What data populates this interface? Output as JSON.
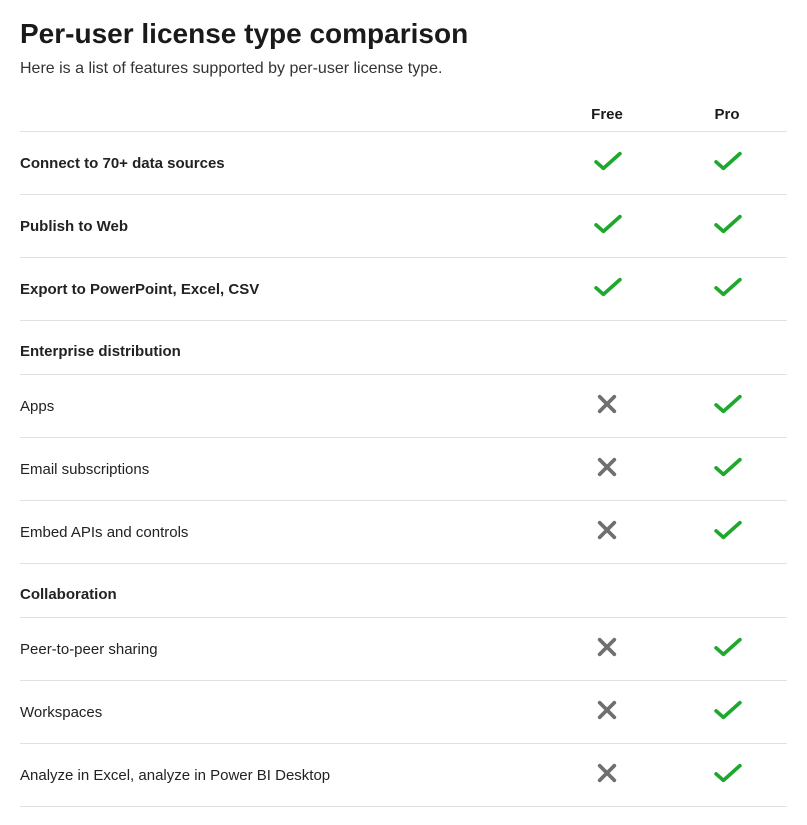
{
  "title": "Per-user license type comparison",
  "subtitle": "Here is a list of features supported by per-user license type.",
  "columns": [
    "Free",
    "Pro"
  ],
  "rows": [
    {
      "type": "feature",
      "bold": true,
      "label": "Connect to 70+ data sources",
      "free": "yes",
      "pro": "yes"
    },
    {
      "type": "feature",
      "bold": true,
      "label": "Publish to Web",
      "free": "yes",
      "pro": "yes"
    },
    {
      "type": "feature",
      "bold": true,
      "label": "Export to PowerPoint, Excel, CSV",
      "free": "yes",
      "pro": "yes"
    },
    {
      "type": "section",
      "label": "Enterprise distribution"
    },
    {
      "type": "feature",
      "bold": false,
      "label": "Apps",
      "free": "no",
      "pro": "yes"
    },
    {
      "type": "feature",
      "bold": false,
      "label": "Email subscriptions",
      "free": "no",
      "pro": "yes"
    },
    {
      "type": "feature",
      "bold": false,
      "label": "Embed APIs and controls",
      "free": "no",
      "pro": "yes"
    },
    {
      "type": "section",
      "label": "Collaboration"
    },
    {
      "type": "feature",
      "bold": false,
      "label": "Peer-to-peer sharing",
      "free": "no",
      "pro": "yes"
    },
    {
      "type": "feature",
      "bold": false,
      "label": "Workspaces",
      "free": "no",
      "pro": "yes"
    },
    {
      "type": "feature",
      "bold": false,
      "label": "Analyze in Excel, analyze in Power BI Desktop",
      "free": "no",
      "pro": "yes"
    }
  ]
}
